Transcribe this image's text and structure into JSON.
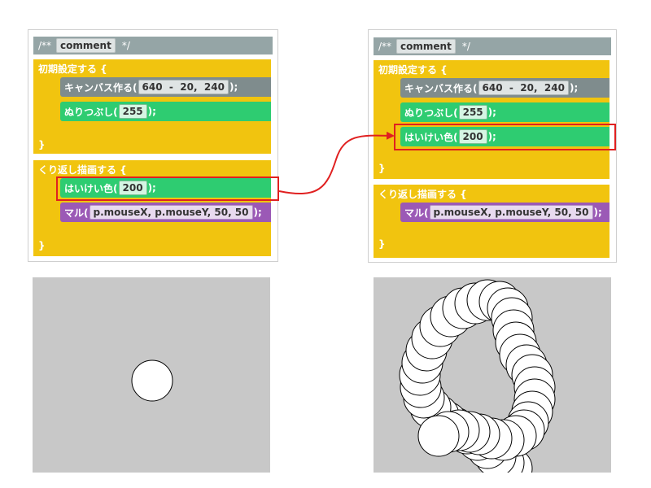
{
  "comment": {
    "open": "/**",
    "word": "comment",
    "close": "*/"
  },
  "setup": {
    "label": "初期設定する {",
    "close": "}"
  },
  "draw": {
    "label": "くり返し描画する {",
    "close": "}"
  },
  "canvas_stmt": {
    "name": "キャンバス作る(",
    "arg1": "640",
    "op": "-",
    "arg2": "20,",
    "arg3": "240",
    "end": ");"
  },
  "fill_stmt": {
    "name": "ぬりつぶし(",
    "arg": "255",
    "end": ");"
  },
  "bg_stmt": {
    "name": "はいけい色(",
    "arg": "200",
    "end": ");"
  },
  "ellipse_stmt": {
    "name": "マル(",
    "arg": "p.mouseX,  p.mouseY,  50,  50",
    "end": ");"
  },
  "colors": {
    "highlight": "#e02020",
    "canvas_bg": "#c8c8c8",
    "yellow": "#f1c40f",
    "green": "#2ecc71",
    "purple": "#9b59b6",
    "gray": "#7f8c8d"
  }
}
